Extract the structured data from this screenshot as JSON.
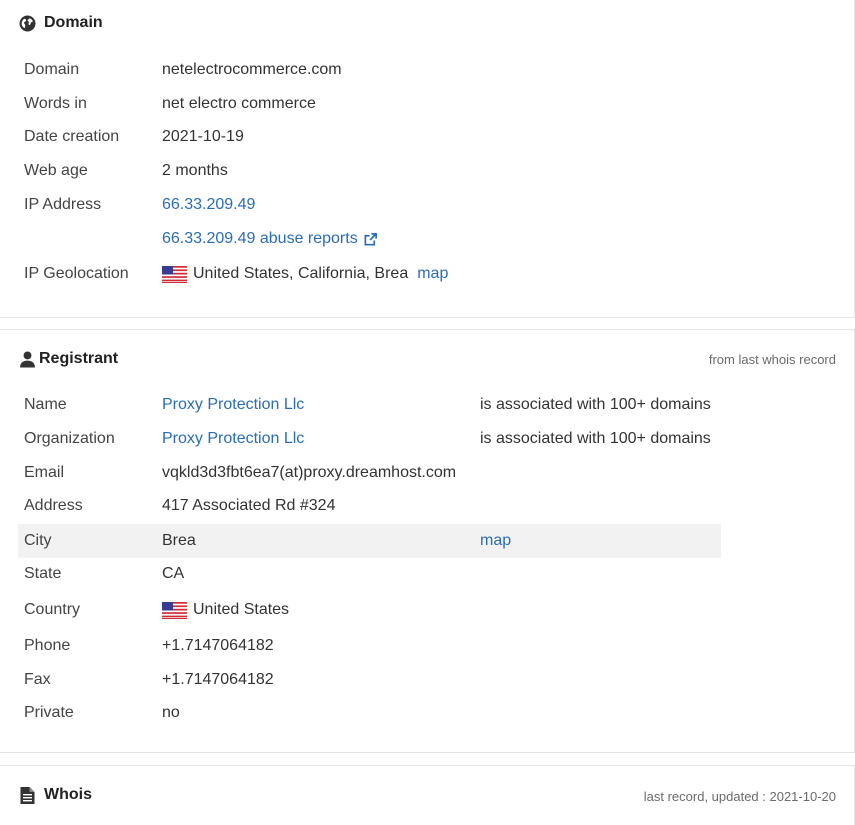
{
  "domain_panel": {
    "title": "Domain",
    "icon": "globe-icon",
    "rows": [
      {
        "label": "Domain",
        "value": "netelectrocommerce.com"
      },
      {
        "label": "Words in",
        "value": "net electro commerce"
      },
      {
        "label": "Date creation",
        "value": "2021-10-19"
      },
      {
        "label": "Web age",
        "value": "2 months"
      },
      {
        "label": "IP Address",
        "value": "66.33.209.49"
      },
      {
        "label": "",
        "value": "66.33.209.49 abuse reports"
      },
      {
        "label": "IP Geolocation",
        "value": "United States, California, Brea",
        "link": "map"
      }
    ]
  },
  "registrant_panel": {
    "title": "Registrant",
    "icon": "user-icon",
    "note": "from last whois record",
    "rows": [
      {
        "label": "Name",
        "value": "Proxy Protection Llc",
        "extra": "is associated with 100+ domains"
      },
      {
        "label": "Organization",
        "value": "Proxy Protection Llc",
        "extra": "is associated with 100+ domains"
      },
      {
        "label": "Email",
        "value": "vqkld3d3fbt6ea7(at)proxy.dreamhost.com"
      },
      {
        "label": "Address",
        "value": "417 Associated Rd #324"
      },
      {
        "label": "City",
        "value": "Brea",
        "extra": "map"
      },
      {
        "label": "State",
        "value": "CA"
      },
      {
        "label": "Country",
        "value": "United States"
      },
      {
        "label": "Phone",
        "value": "+1.7147064182"
      },
      {
        "label": "Fax",
        "value": "+1.7147064182"
      },
      {
        "label": "Private",
        "value": "no"
      }
    ]
  },
  "whois_panel": {
    "title": "Whois",
    "icon": "document-icon",
    "note": "last record, updated : 2021-10-20"
  },
  "colors": {
    "link": "#2a6db5",
    "text": "#333333",
    "highlight": "#f2f2f2"
  }
}
